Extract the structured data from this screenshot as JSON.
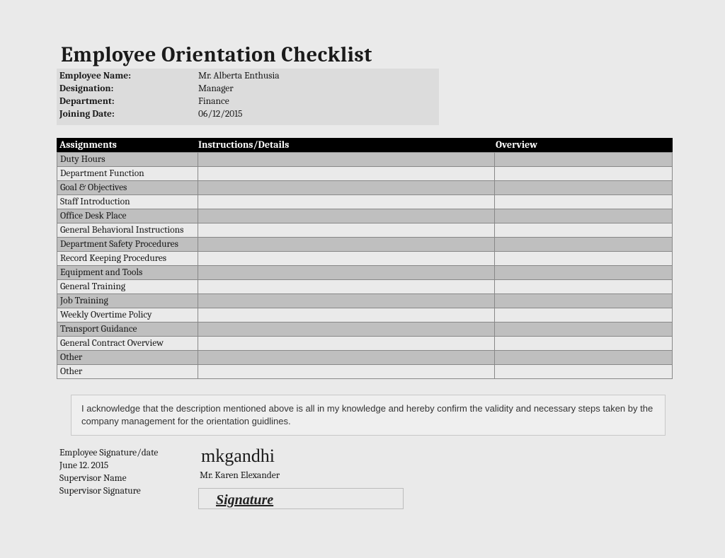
{
  "title": "Employee Orientation Checklist",
  "info": {
    "rows": [
      {
        "label": "Employee Name:",
        "value": "Mr. Alberta Enthusia"
      },
      {
        "label": "Designation:",
        "value": "Manager"
      },
      {
        "label": "Department:",
        "value": "Finance"
      },
      {
        "label": "Joining Date:",
        "value": "06/12/2015"
      }
    ]
  },
  "table": {
    "headers": {
      "col1": "Assignments",
      "col2": "Instructions/Details",
      "col3": "Overview"
    },
    "rows": [
      {
        "assignment": "Duty Hours",
        "details": "",
        "overview": "",
        "shaded": true
      },
      {
        "assignment": "Department Function",
        "details": "",
        "overview": "",
        "shaded": false
      },
      {
        "assignment": "Goal & Objectives",
        "details": "",
        "overview": "",
        "shaded": true
      },
      {
        "assignment": "Staff Introduction",
        "details": "",
        "overview": "",
        "shaded": false
      },
      {
        "assignment": "Office Desk Place",
        "details": "",
        "overview": "",
        "shaded": true
      },
      {
        "assignment": "General Behavioral Instructions",
        "details": "",
        "overview": "",
        "shaded": false
      },
      {
        "assignment": "Department Safety Procedures",
        "details": "",
        "overview": "",
        "shaded": true
      },
      {
        "assignment": "Record Keeping Procedures",
        "details": "",
        "overview": "",
        "shaded": false
      },
      {
        "assignment": "Equipment and Tools",
        "details": "",
        "overview": "",
        "shaded": true
      },
      {
        "assignment": "General Training",
        "details": "",
        "overview": "",
        "shaded": false
      },
      {
        "assignment": "Job Training",
        "details": "",
        "overview": "",
        "shaded": true
      },
      {
        "assignment": "Weekly Overtime Policy",
        "details": "",
        "overview": "",
        "shaded": false
      },
      {
        "assignment": "Transport Guidance",
        "details": "",
        "overview": "",
        "shaded": true
      },
      {
        "assignment": "General Contract Overview",
        "details": "",
        "overview": "",
        "shaded": false
      },
      {
        "assignment": "Other",
        "details": "",
        "overview": "",
        "shaded": true
      },
      {
        "assignment": "Other",
        "details": "",
        "overview": "",
        "shaded": false
      }
    ]
  },
  "acknowledgement": "I acknowledge that the description mentioned above is all in my knowledge and hereby confirm the validity and necessary steps taken by the company management for the orientation guidlines.",
  "signatures": {
    "emp_sig_label": "Employee Signature/date",
    "emp_sig_date": "June 12. 2015",
    "sup_name_label": "Supervisor Name",
    "sup_sig_label": "Supervisor Signature",
    "emp_handwritten": "mkgandhi",
    "sup_name_value": "Mr. Karen Elexander",
    "sup_sig_placeholder": "Signature"
  }
}
